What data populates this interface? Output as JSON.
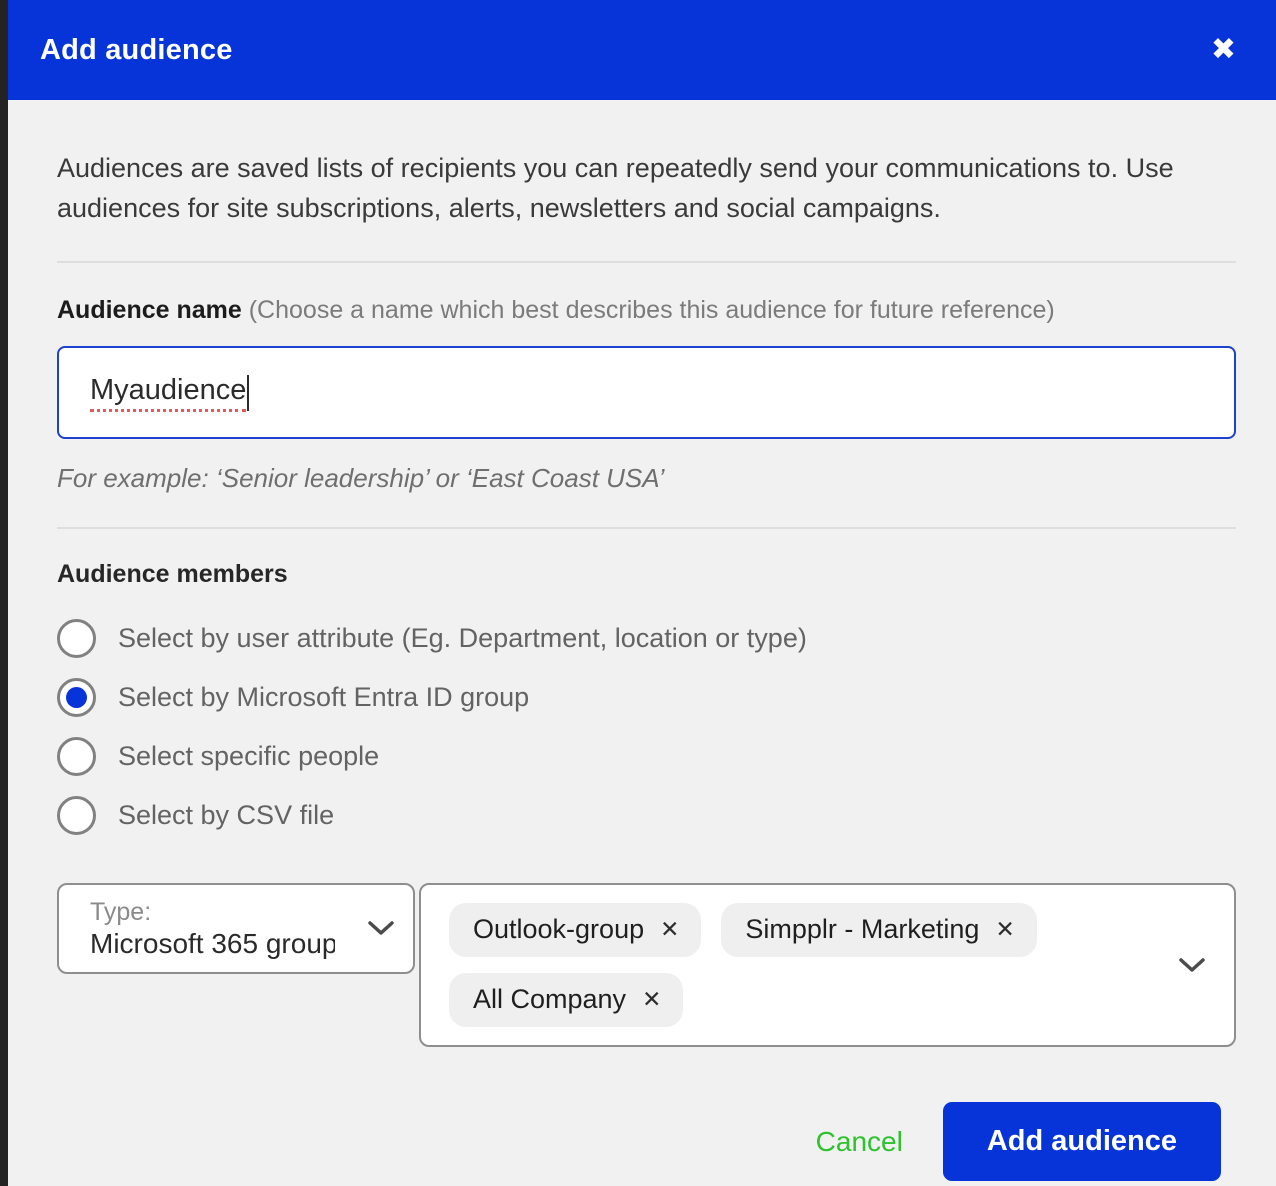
{
  "dialog": {
    "title": "Add audience",
    "close_icon": "✖",
    "description": "Audiences are saved lists of recipients you can repeatedly send your communications to. Use audiences for site subscriptions, alerts, newsletters and social campaigns."
  },
  "audience_name": {
    "label": "Audience name",
    "hint": "(Choose a name which best describes this audience for future reference)",
    "value": "Myaudience",
    "example": "For example: ‘Senior leadership’ or ‘East Coast USA’"
  },
  "audience_members": {
    "label": "Audience members",
    "options": [
      {
        "label": "Select by user attribute (Eg. Department, location or type)",
        "selected": false
      },
      {
        "label": "Select by Microsoft Entra ID group",
        "selected": true
      },
      {
        "label": "Select specific people",
        "selected": false
      },
      {
        "label": "Select by CSV file",
        "selected": false
      }
    ]
  },
  "group_type": {
    "label": "Type:",
    "value": "Microsoft 365 group"
  },
  "selected_groups": {
    "chips": [
      {
        "label": "Outlook-group"
      },
      {
        "label": "Simpplr - Marketing"
      },
      {
        "label": "All Company"
      }
    ],
    "remove_icon": "✕"
  },
  "footer": {
    "cancel_label": "Cancel",
    "submit_label": "Add audience"
  },
  "colors": {
    "primary_blue": "#0634d8",
    "cancel_green": "#2ec22e",
    "background": "#f1f1f2",
    "edge_strip": "#232323"
  }
}
